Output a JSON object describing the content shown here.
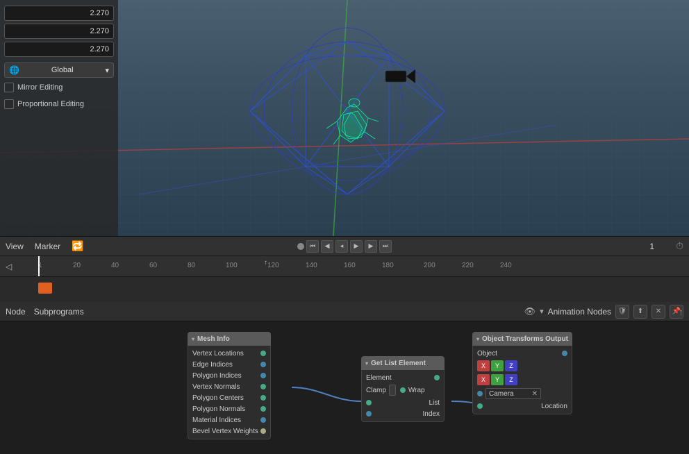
{
  "viewport": {
    "values": {
      "x": "2.270",
      "y": "2.270",
      "z": "2.270"
    },
    "transform_space": "Global",
    "mirror_editing": "Mirror Editing",
    "proportional_editing": "Proportional Editing"
  },
  "timeline": {
    "menu": {
      "view": "View",
      "marker": "Marker"
    },
    "frame_current": "1",
    "ruler_marks": [
      "1",
      "20",
      "40",
      "80",
      "120",
      "140",
      "160",
      "200",
      "220",
      "240",
      "60",
      "100",
      "180"
    ],
    "ruler_values": [
      1,
      20,
      40,
      60,
      80,
      100,
      120,
      140,
      160,
      180,
      200,
      220,
      240
    ]
  },
  "node_editor": {
    "menu": {
      "node": "Node",
      "subprograms": "Subprograms"
    },
    "title": "Animation Nodes",
    "nodes": {
      "mesh_info": {
        "label": "Mesh Info",
        "rows": [
          "Vertex Locations",
          "Edge Indices",
          "Polygon Indices",
          "Vertex Normals",
          "Polygon Centers",
          "Polygon Normals",
          "Material Indices",
          "Bevel Vertex Weights"
        ]
      },
      "get_list_element": {
        "label": "Get List Element",
        "rows": [
          "Element"
        ],
        "fields": {
          "clamp_label": "Clamp",
          "wrap_label": "Wrap",
          "list_label": "List",
          "index_label": "Index"
        }
      },
      "object_transforms_output": {
        "label": "Object Transforms Output",
        "rows": [
          "Object",
          "Location"
        ],
        "xyz_labels": [
          "X",
          "Y",
          "Z"
        ],
        "camera_label": "Camera"
      }
    }
  },
  "icons": {
    "dropdown_arrow": "▾",
    "play": "▶",
    "pause": "⏸",
    "prev_frame": "⏮",
    "next_frame": "⏭",
    "jump_start": "⏪",
    "jump_end": "⏩",
    "clock": "⏱",
    "shield": "🛡",
    "up_arrow": "↑",
    "collapse": "▾",
    "x_close": "✕",
    "pin": "📌",
    "dot": "●"
  }
}
